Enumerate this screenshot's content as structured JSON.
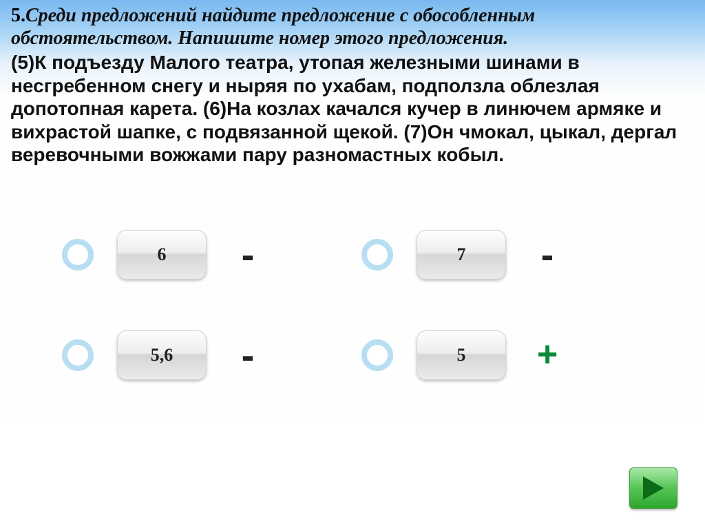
{
  "question": {
    "number": "5.",
    "prompt_italic": "Среди предложений найдите предложение с обособленным обстоятельством. Напишите номер этого предложения.",
    "passage": "(5)К подъезду Малого театра, утопая железными шинами в несгребенном снегу и ныряя по ухабам, подползла облезлая допотопная карета. (6)На козлах качался кучер в линючем армяке и вихрастой шапке, с подвязанной щекой. (7)Он чмокал, цыкал, дергал веревочными вожжами пару разномастных кобыл."
  },
  "options": [
    {
      "label": "6",
      "mark": "-",
      "correct": false
    },
    {
      "label": "7",
      "mark": "-",
      "correct": false
    },
    {
      "label": "5,6",
      "mark": "-",
      "correct": false
    },
    {
      "label": "5",
      "mark": "+",
      "correct": true
    }
  ],
  "nav": {
    "next": "next"
  }
}
